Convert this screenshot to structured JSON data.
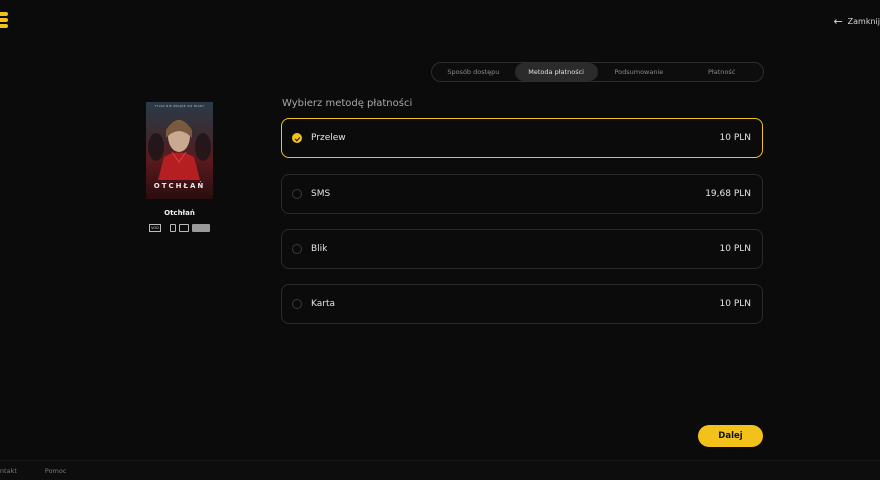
{
  "header": {
    "close_label": "Zamknij",
    "close_arrow": "←"
  },
  "stepper": {
    "steps": [
      {
        "label": "Sposób dostępu",
        "active": false
      },
      {
        "label": "Metoda płatności",
        "active": true
      },
      {
        "label": "Podsumowanie",
        "active": false
      },
      {
        "label": "Płatność",
        "active": false
      }
    ]
  },
  "movie": {
    "poster_title": "OTCHŁAŃ",
    "poster_tagline": "TYLKO NIE ZNAJDŹ SIĘ NIGDY",
    "name": "Otchłań",
    "vod_badge": "VOD"
  },
  "payment": {
    "title": "Wybierz metodę płatności",
    "options": [
      {
        "label": "Przelew",
        "price": "10 PLN",
        "selected": true
      },
      {
        "label": "SMS",
        "price": "19,68 PLN",
        "selected": false
      },
      {
        "label": "Blik",
        "price": "10 PLN",
        "selected": false
      },
      {
        "label": "Karta",
        "price": "10 PLN",
        "selected": false
      }
    ]
  },
  "actions": {
    "next_label": "Dalej"
  },
  "footer": {
    "contact_label": "Kontakt",
    "help_label": "Pomoc"
  },
  "colors": {
    "accent": "#f2c21b",
    "background": "#0b0b0b"
  }
}
